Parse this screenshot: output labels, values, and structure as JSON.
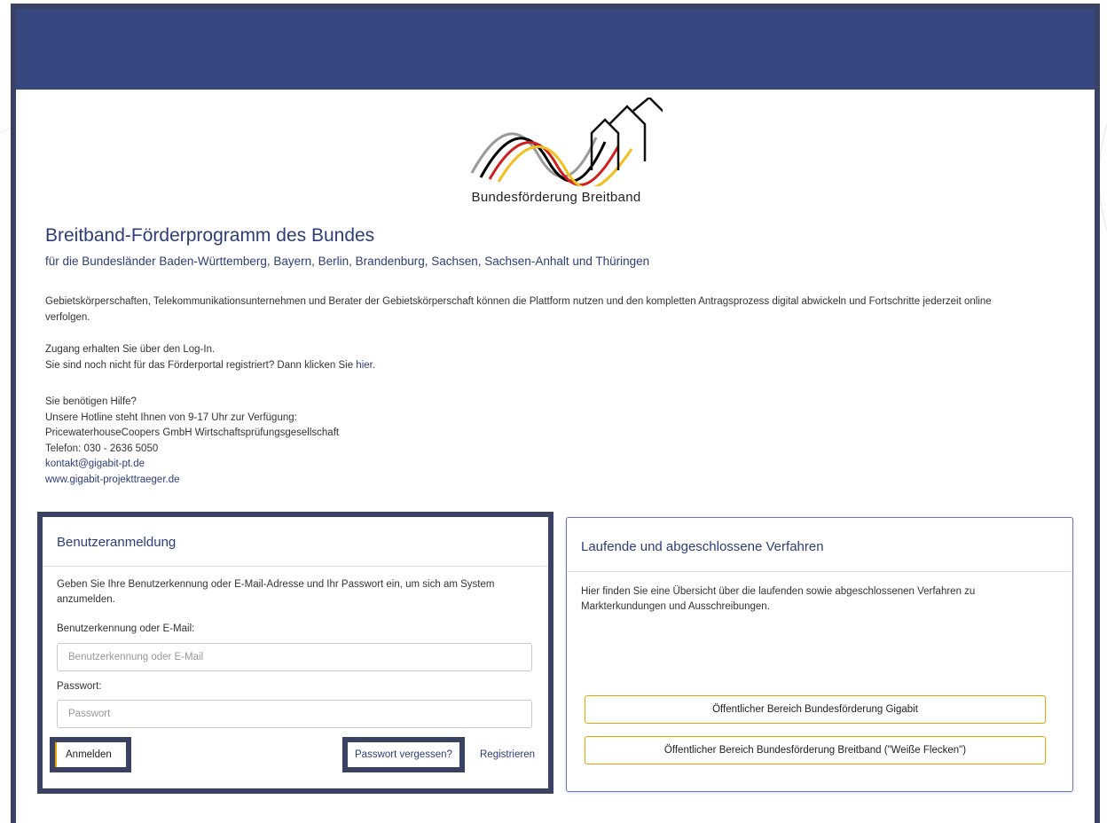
{
  "logo": {
    "text": "Bundesförderung Breitband"
  },
  "heading": {
    "title": "Breitband-Förderprogramm des Bundes",
    "subtitle": "für die Bundesländer Baden-Württemberg, Bayern, Berlin, Brandenburg, Sachsen, Sachsen-Anhalt und Thüringen"
  },
  "intro": {
    "line1": "Gebietskörperschaften, Telekommunikationsunternehmen und Berater der Gebietskörperschaft können die Plattform nutzen und den kompletten Antragsprozess digital abwickeln und Fortschritte jederzeit online",
    "line2": "verfolgen."
  },
  "access": {
    "line1": "Zugang erhalten Sie über den Log-In.",
    "line2_prefix": "Sie sind noch nicht für das Förderportal registriert? Dann klicken Sie",
    "line2_link": "hier",
    "line2_suffix": "."
  },
  "help": {
    "q": "Sie benötigen Hilfe?",
    "hotline": "Unsere Hotline steht Ihnen von 9-17 Uhr zur Verfügung:",
    "company": "PricewaterhouseCoopers GmbH Wirtschaftsprüfungsgesellschaft",
    "phone": "Telefon: 030 - 2636 5050",
    "email": "kontakt@gigabit-pt.de",
    "web": "www.gigabit-projekttraeger.de"
  },
  "login": {
    "title": "Benutzeranmeldung",
    "description": "Geben Sie Ihre Benutzerkennung oder E-Mail-Adresse und Ihr Passwort ein, um sich am System anzumelden.",
    "user_label": "Benutzerkennung oder E-Mail:",
    "user_placeholder": "Benutzerkennung oder E-Mail",
    "password_label": "Passwort:",
    "password_placeholder": "Passwort",
    "login_button": "Anmelden",
    "forgot_link": "Passwort vergessen?",
    "register_link": "Registrieren"
  },
  "procedures": {
    "title": "Laufende und abgeschlossene Verfahren",
    "description": "Hier finden Sie eine Übersicht über die laufenden sowie abgeschlossenen Verfahren zu Markterkundungen und Ausschreibungen.",
    "button1": "Öffentlicher Bereich Bundesförderung Gigabit",
    "button2": "Öffentlicher Bereich Bundesförderung Breitband (\"Weiße Flecken\")"
  },
  "colors": {
    "header_bar": "#374780",
    "highlight_border": "#3a4263",
    "heading_text": "#2e3d7a",
    "button_accent": "#e5a500"
  }
}
